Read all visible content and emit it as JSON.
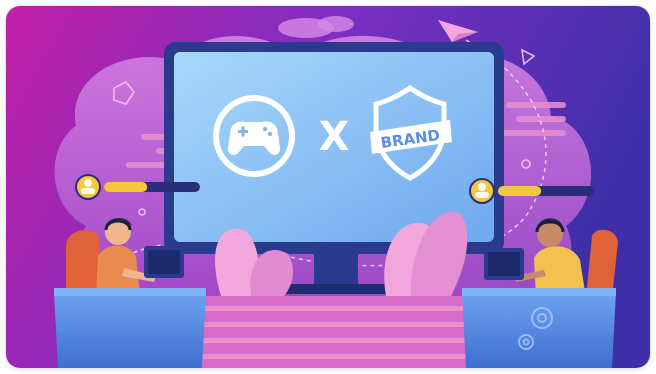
{
  "illustration": {
    "logo_left_icon": "gamepad-icon",
    "separator": "X",
    "badge_text": "BRAND",
    "badge_icon": "shield-icon",
    "progress_left": 0.45,
    "progress_right": 0.45,
    "colors": {
      "bg_start": "#c21fa6",
      "bg_mid": "#7a2fc2",
      "bg_end": "#3e2fa8",
      "blob": "#c86ad8",
      "screen": "#8fc6f4",
      "bezel": "#2a3a8c",
      "desk": "#5a8de6",
      "stripe_pink": "#e98fcf",
      "leaf_pink": "#f2a7dc",
      "hair_orange": "#e87a2a",
      "shirt_yellow": "#f2c14e",
      "bar_gold": "#f3c83c"
    }
  }
}
